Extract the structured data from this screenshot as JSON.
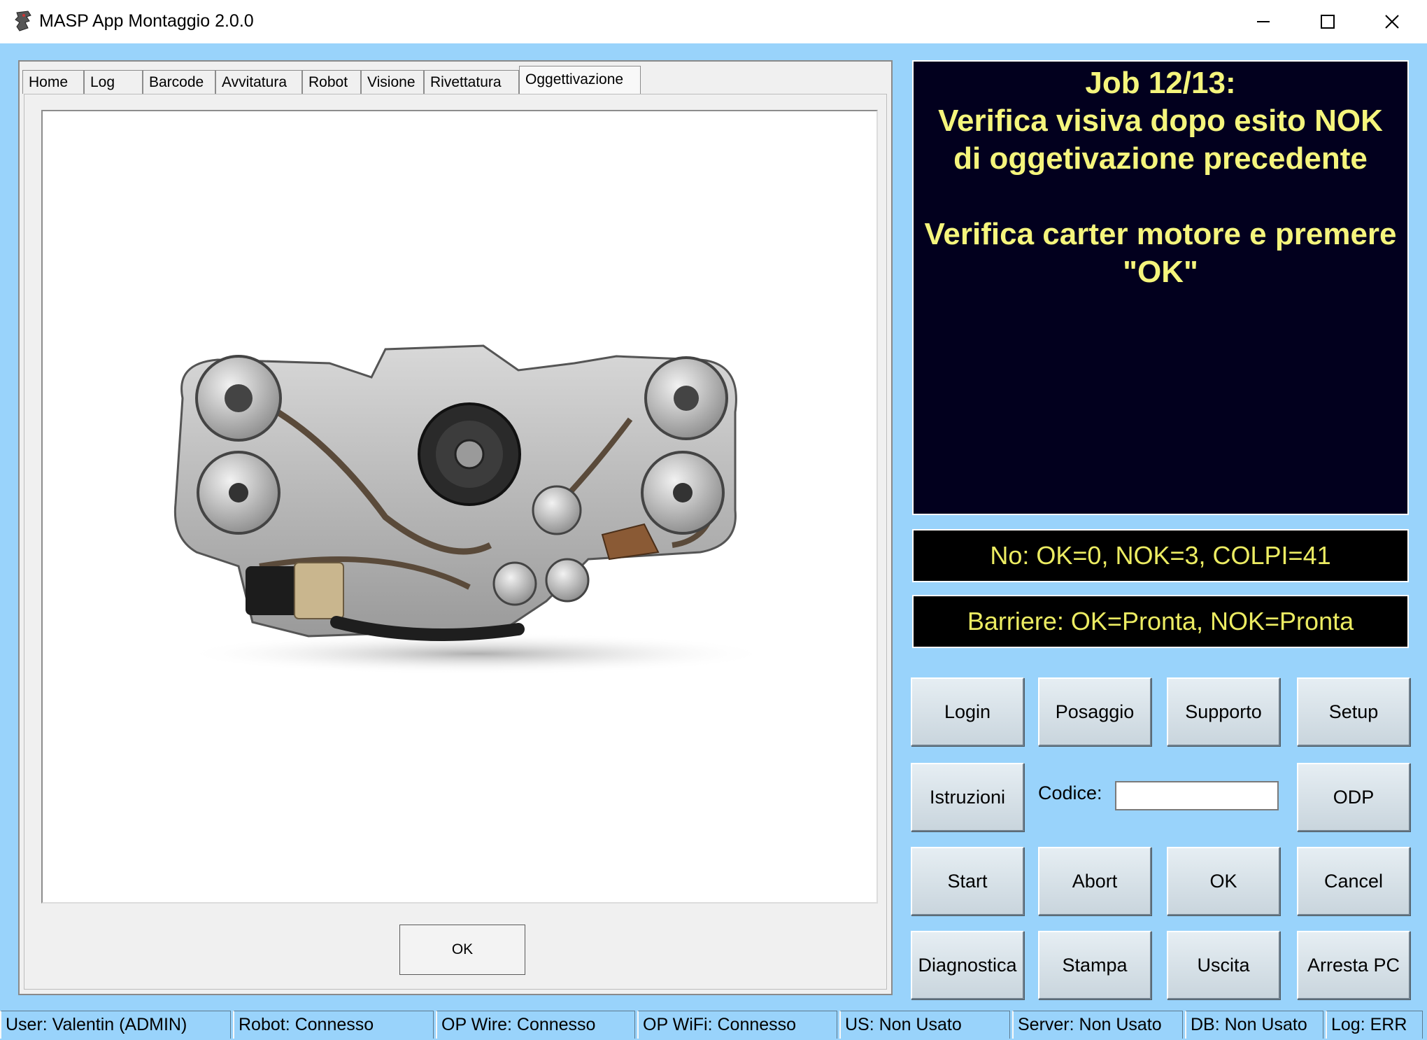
{
  "window": {
    "title": "MASP App Montaggio 2.0.0",
    "icon": "masp-app-icon",
    "controls": [
      "minimize-icon",
      "maximize-icon",
      "close-icon"
    ]
  },
  "tabs": {
    "items": [
      "Home",
      "Log",
      "Barcode",
      "Avvitatura",
      "Robot",
      "Visione",
      "Rivettatura",
      "Oggettivazione"
    ],
    "active": "Oggettivazione"
  },
  "tab_page": {
    "image": "engine-image",
    "ok_label": "OK"
  },
  "job_panel": {
    "line1": "Job 12/13:",
    "line2": "Verifica visiva dopo esito NOK",
    "line3": "di oggetivazione precedente",
    "line4": "Verifica carter motore e premere",
    "line5": "\"OK\""
  },
  "counters": "No: OK=0, NOK=3, COLPI=41",
  "barriers": "Barriere: OK=Pronta, NOK=Pronta",
  "buttons": {
    "login": "Login",
    "posaggio": "Posaggio",
    "supporto": "Supporto",
    "setup": "Setup",
    "istruzioni": "Istruzioni",
    "odp": "ODP",
    "start": "Start",
    "abort": "Abort",
    "ok": "OK",
    "cancel": "Cancel",
    "diagnostica": "Diagnostica",
    "stampa": "Stampa",
    "uscita": "Uscita",
    "arresta": "Arresta PC"
  },
  "codice": {
    "label": "Codice:",
    "value": ""
  },
  "statusbar": {
    "user": "User: Valentin (ADMIN)",
    "robot": "Robot: Connesso",
    "op_wire": "OP Wire: Connesso",
    "op_wifi": "OP WiFi: Connesso",
    "us": "US: Non Usato",
    "server": "Server: Non Usato",
    "db": "DB: Non Usato",
    "log": "Log: ERR"
  },
  "colors": {
    "client_bg": "#99d3fb",
    "job_bg": "#02001e",
    "job_text": "#f5f57c",
    "status_text": "#ecec62"
  }
}
